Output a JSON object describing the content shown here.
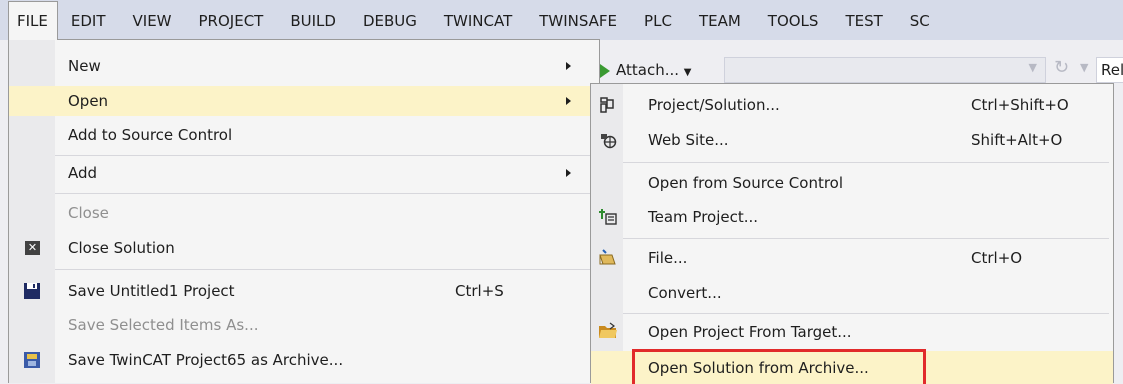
{
  "menubar": {
    "items": [
      "FILE",
      "EDIT",
      "VIEW",
      "PROJECT",
      "BUILD",
      "DEBUG",
      "TWINCAT",
      "TWINSAFE",
      "PLC",
      "TEAM",
      "TOOLS",
      "TEST",
      "SC"
    ]
  },
  "toolbar": {
    "attach_label": "Attach...",
    "configuration": "Release"
  },
  "file_menu": {
    "items": [
      {
        "label": "New",
        "shortcut": "",
        "submenu": true,
        "disabled": false
      },
      {
        "label": "Open",
        "shortcut": "",
        "submenu": true,
        "disabled": false,
        "highlighted": true
      },
      {
        "label": "Add to Source Control",
        "shortcut": "",
        "submenu": false,
        "disabled": false
      },
      {
        "label": "Add",
        "shortcut": "",
        "submenu": true,
        "disabled": false
      },
      {
        "label": "Close",
        "shortcut": "",
        "submenu": false,
        "disabled": true
      },
      {
        "label": "Close Solution",
        "shortcut": "",
        "submenu": false,
        "disabled": false,
        "icon": "close-solution-icon"
      },
      {
        "label": "Save Untitled1 Project",
        "shortcut": "Ctrl+S",
        "submenu": false,
        "disabled": false,
        "icon": "save-icon"
      },
      {
        "label": "Save Selected Items As...",
        "shortcut": "",
        "submenu": false,
        "disabled": true
      },
      {
        "label": "Save TwinCAT Project65 as Archive...",
        "shortcut": "",
        "submenu": false,
        "disabled": false,
        "icon": "archive-save-icon"
      }
    ]
  },
  "open_submenu": {
    "items": [
      {
        "label": "Project/Solution...",
        "shortcut": "Ctrl+Shift+O",
        "icon": "project-solution-icon"
      },
      {
        "label": "Web Site...",
        "shortcut": "Shift+Alt+O",
        "icon": "web-site-icon"
      },
      {
        "label": "Open from Source Control",
        "shortcut": ""
      },
      {
        "label": "Team Project...",
        "shortcut": "",
        "icon": "team-project-icon"
      },
      {
        "label": "File...",
        "shortcut": "Ctrl+O",
        "icon": "file-open-icon"
      },
      {
        "label": "Convert...",
        "shortcut": ""
      },
      {
        "label": "Open Project From Target...",
        "shortcut": "",
        "icon": "folder-open-icon"
      },
      {
        "label": "Open Solution from Archive...",
        "shortcut": "",
        "highlighted": true,
        "boxed": true
      }
    ]
  },
  "colors": {
    "menubar_bg": "#d6dbe9",
    "menu_bg": "#f5f5f5",
    "highlight": "#fcf3c8",
    "annotation_box": "#e12a2a",
    "run_arrow": "#3a9a32"
  }
}
